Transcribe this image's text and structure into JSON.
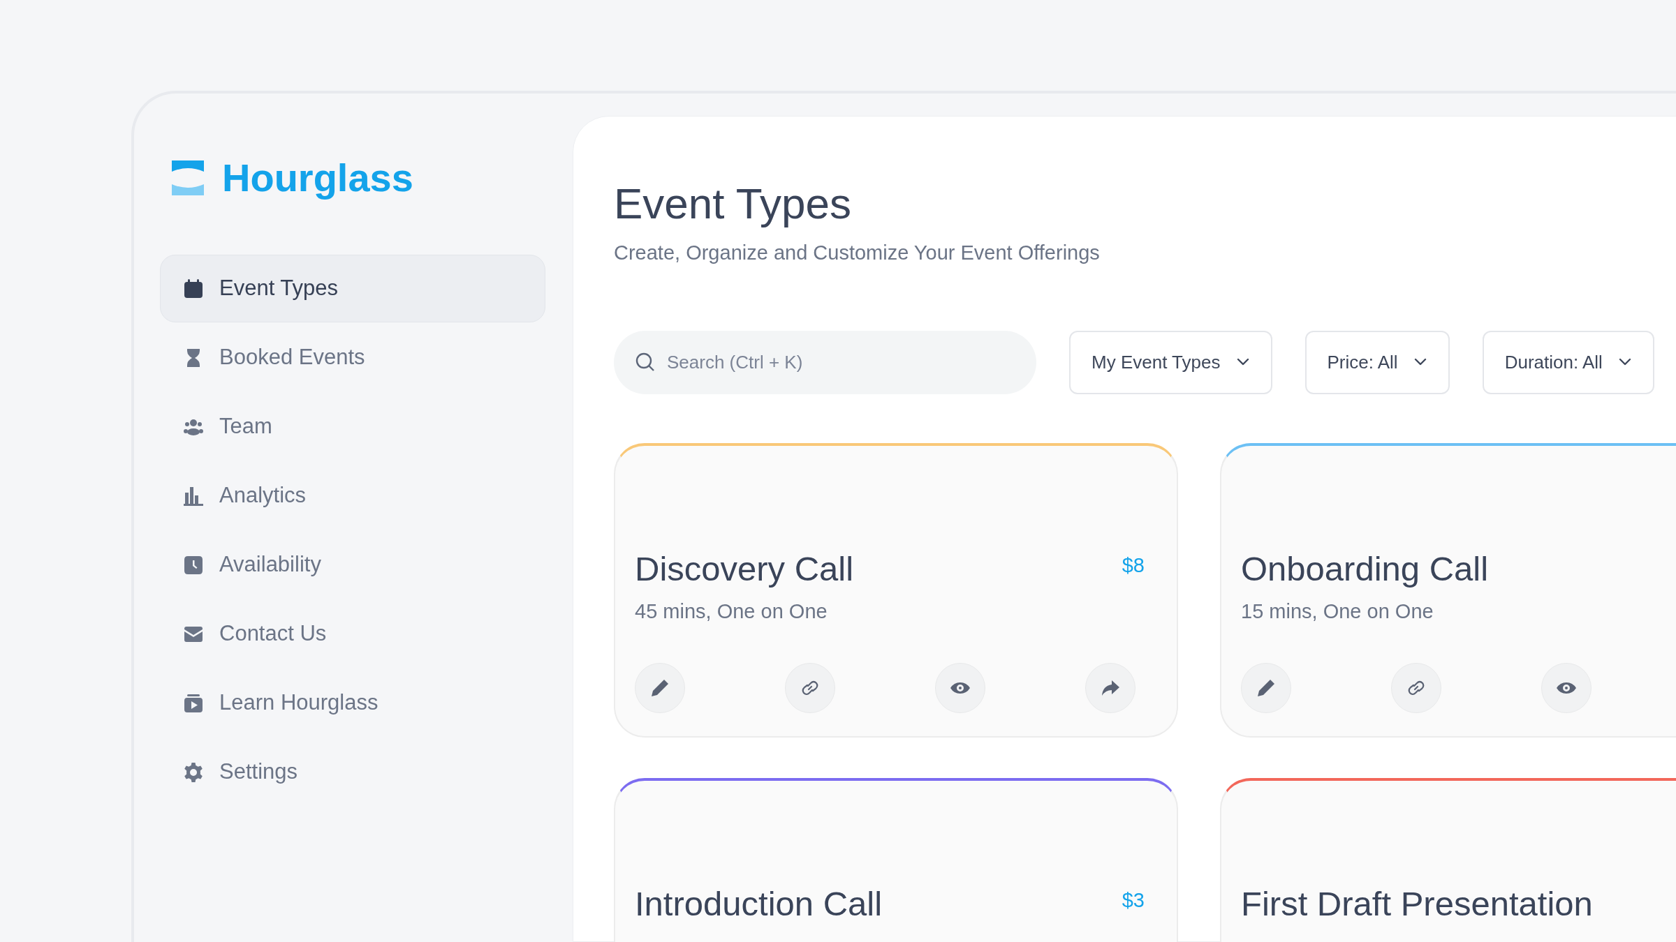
{
  "brand": "Hourglass",
  "sidebar": {
    "items": [
      {
        "label": "Event Types",
        "selected": true
      },
      {
        "label": "Booked Events",
        "selected": false
      },
      {
        "label": "Team",
        "selected": false
      },
      {
        "label": "Analytics",
        "selected": false
      },
      {
        "label": "Availability",
        "selected": false
      },
      {
        "label": "Contact Us",
        "selected": false
      },
      {
        "label": "Learn Hourglass",
        "selected": false
      },
      {
        "label": "Settings",
        "selected": false
      }
    ]
  },
  "header": {
    "title": "Event Types",
    "subtitle": "Create, Organize and Customize Your Event Offerings"
  },
  "search": {
    "placeholder": "Search (Ctrl + K)"
  },
  "filters": [
    "My Event Types",
    "Price: All",
    "Duration: All"
  ],
  "cards": [
    {
      "title": "Discovery Call",
      "details": "45 mins, One on One",
      "price": "$8",
      "color": "#f9c878",
      "actions": [
        {
          "kind": "edit"
        },
        {
          "kind": "link"
        },
        {
          "kind": "view"
        },
        {
          "kind": "share"
        }
      ]
    },
    {
      "title": "Onboarding Call",
      "details": "15 mins, One on One",
      "color": "#6cc0f4",
      "actions": [
        {
          "kind": "edit"
        },
        {
          "kind": "link"
        },
        {
          "kind": "view"
        }
      ]
    },
    {
      "title": "Introduction Call",
      "price": "$3",
      "color": "#7c6cf0"
    },
    {
      "title": "First Draft Presentation",
      "color": "#f2675a"
    }
  ]
}
